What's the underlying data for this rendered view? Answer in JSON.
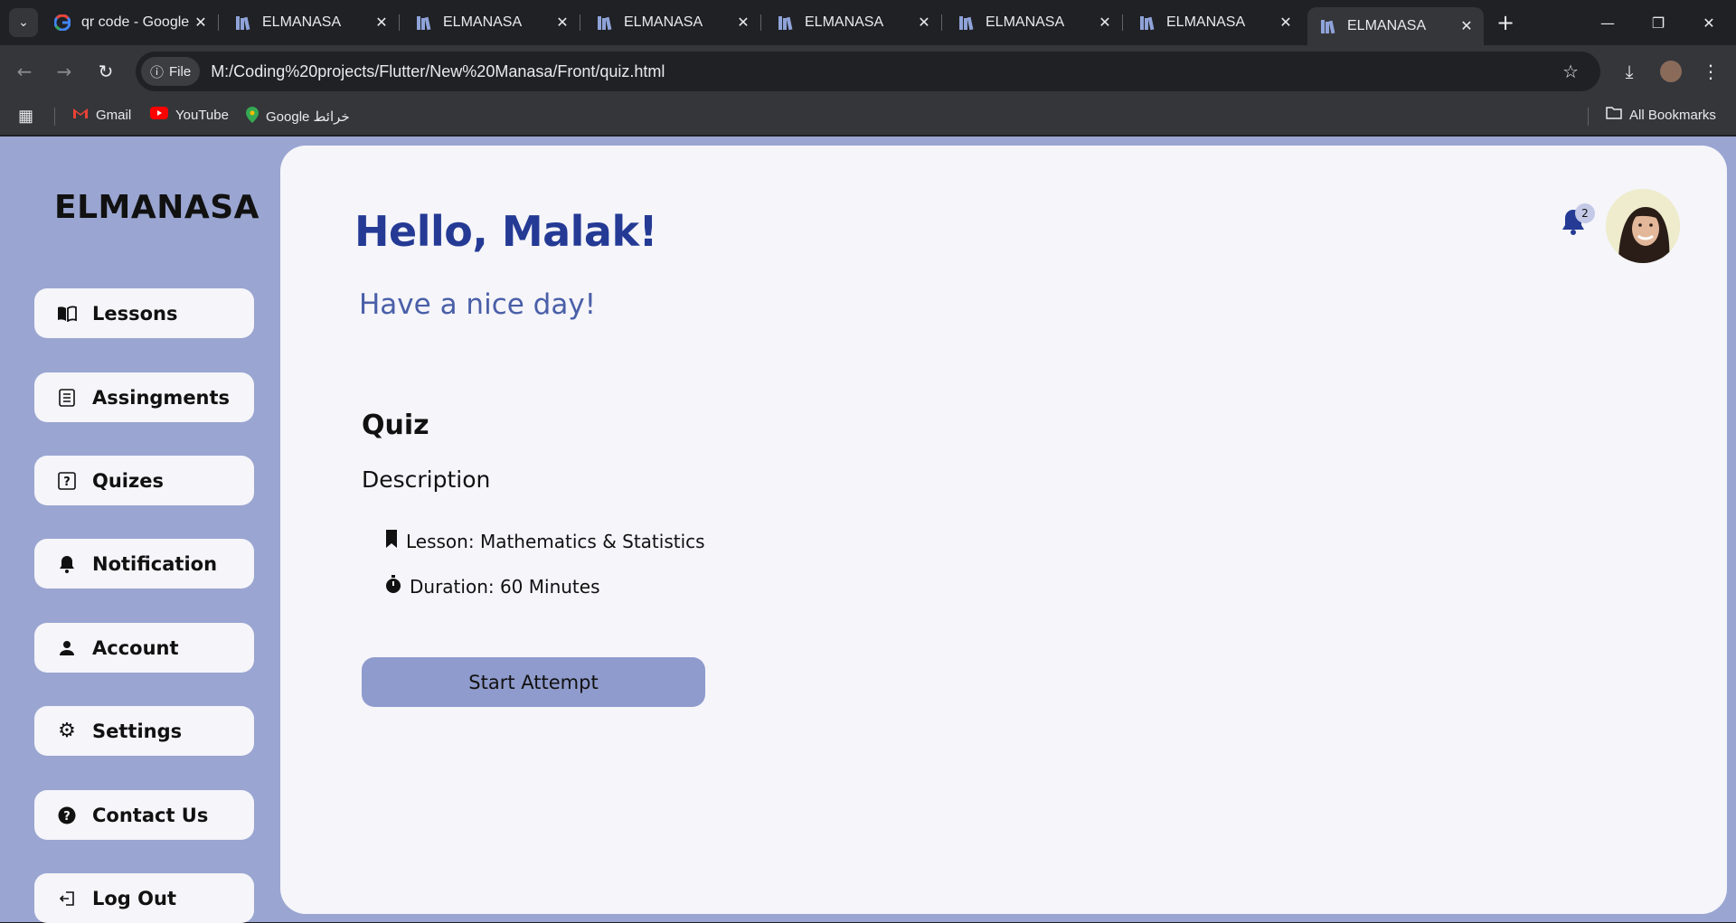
{
  "browser": {
    "tabs": [
      {
        "title": "qr code - Google",
        "icon": "google-icon"
      },
      {
        "title": "ELMANASA",
        "icon": "books-icon"
      },
      {
        "title": "ELMANASA",
        "icon": "books-icon"
      },
      {
        "title": "ELMANASA",
        "icon": "books-icon"
      },
      {
        "title": "ELMANASA",
        "icon": "books-icon"
      },
      {
        "title": "ELMANASA",
        "icon": "books-icon"
      },
      {
        "title": "ELMANASA",
        "icon": "books-icon"
      },
      {
        "title": "ELMANASA",
        "icon": "books-icon",
        "active": true
      }
    ],
    "site_chip": "File",
    "url": "M:/Coding%20projects/Flutter/New%20Manasa/Front/quiz.html",
    "bookmarks": [
      {
        "label": "Gmail",
        "icon": "gmail-icon"
      },
      {
        "label": "YouTube",
        "icon": "youtube-icon"
      },
      {
        "label": "Google خرائط",
        "icon": "maps-pin-icon"
      }
    ],
    "all_bookmarks": "All Bookmarks"
  },
  "sidebar": {
    "logo": "ELMANASA",
    "items": [
      {
        "label": "Lessons",
        "icon": "book-icon"
      },
      {
        "label": "Assingments",
        "icon": "list-icon"
      },
      {
        "label": "Quizes",
        "icon": "question-icon"
      },
      {
        "label": "Notification",
        "icon": "bell-icon"
      },
      {
        "label": "Account",
        "icon": "user-icon"
      },
      {
        "label": "Settings",
        "icon": "gear-icon"
      },
      {
        "label": "Contact Us",
        "icon": "help-circle-icon"
      },
      {
        "label": "Log Out",
        "icon": "logout-icon"
      }
    ]
  },
  "header": {
    "greeting": "Hello, Malak!",
    "subtitle": "Have a nice day!",
    "notification_count": "2"
  },
  "quiz": {
    "heading": "Quiz",
    "description_heading": "Description",
    "lesson": "Lesson: Mathematics & Statistics",
    "duration": "Duration: 60 Minutes",
    "start_button": "Start Attempt"
  },
  "colors": {
    "sidebar_bg": "#9aa5d1",
    "panel_bg": "#f5f5fa",
    "greeting": "#243a94",
    "subtitle": "#4a5fa8",
    "button": "#8f9bcc"
  }
}
